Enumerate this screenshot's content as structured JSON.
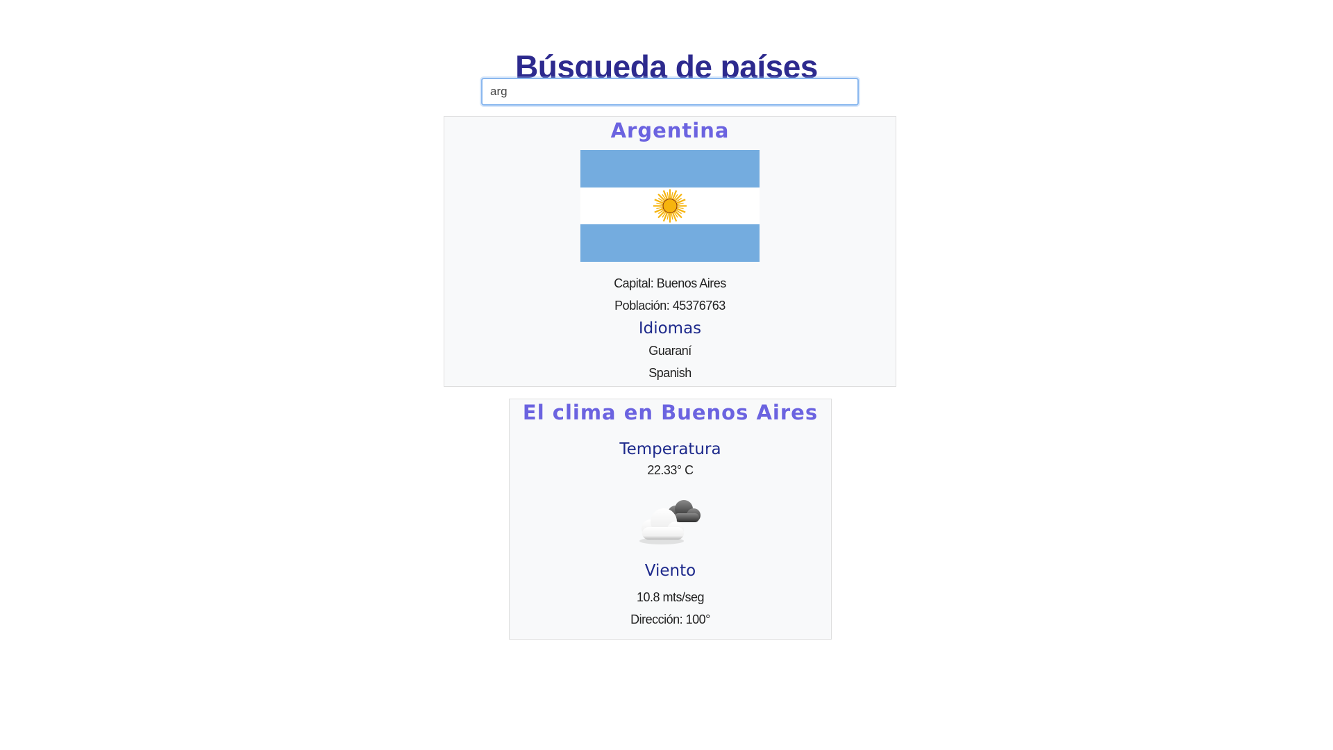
{
  "header": {
    "title": "Búsqueda de países"
  },
  "search": {
    "value": "arg",
    "placeholder": ""
  },
  "country": {
    "name": "Argentina",
    "flag_colors": {
      "stripe": "#74acdf",
      "center": "#ffffff",
      "sun": "#f6b40e",
      "sun_outline": "#85340a"
    },
    "capital_line": "Capital: Buenos Aires",
    "population_line": "Población: 45376763",
    "languages_heading": "Idiomas",
    "languages": [
      "Guaraní",
      "Spanish"
    ]
  },
  "weather": {
    "heading": "El clima en Buenos Aires",
    "temperature_heading": "Temperatura",
    "temperature_value": "22.33° C",
    "icon": "cloud-icon",
    "wind_heading": "Viento",
    "wind_speed": "10.8 mts/seg",
    "wind_direction": "Dirección: 100°"
  },
  "colors": {
    "title": "#2d2a8e",
    "card_heading": "#6b63e0",
    "sub_heading": "#1e2a8c",
    "card_background": "#f8f9fa",
    "card_border": "#dedede"
  }
}
